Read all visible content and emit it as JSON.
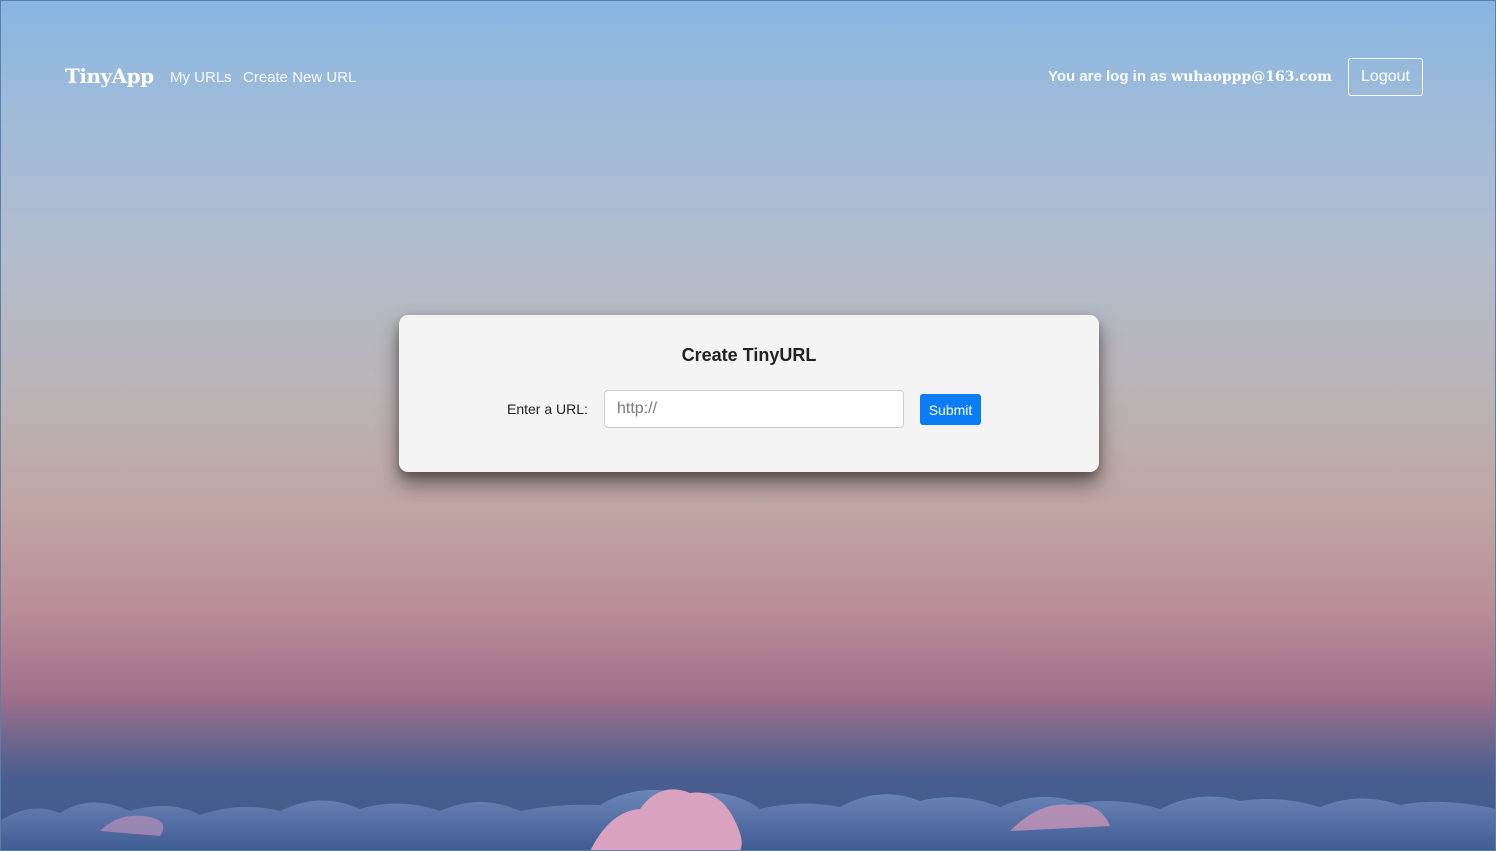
{
  "navbar": {
    "brand": "TinyApp",
    "links": [
      {
        "label": "My URLs"
      },
      {
        "label": "Create New URL"
      }
    ],
    "login_prefix": "You are log in as",
    "user_email": "wuhaoppp@163.com",
    "logout_label": "Logout"
  },
  "form": {
    "title": "Create TinyURL",
    "url_label": "Enter a URL:",
    "url_placeholder": "http://",
    "submit_label": "Submit"
  },
  "colors": {
    "submit_button": "#0a7cf5",
    "card_background": "#f4f4f4"
  }
}
